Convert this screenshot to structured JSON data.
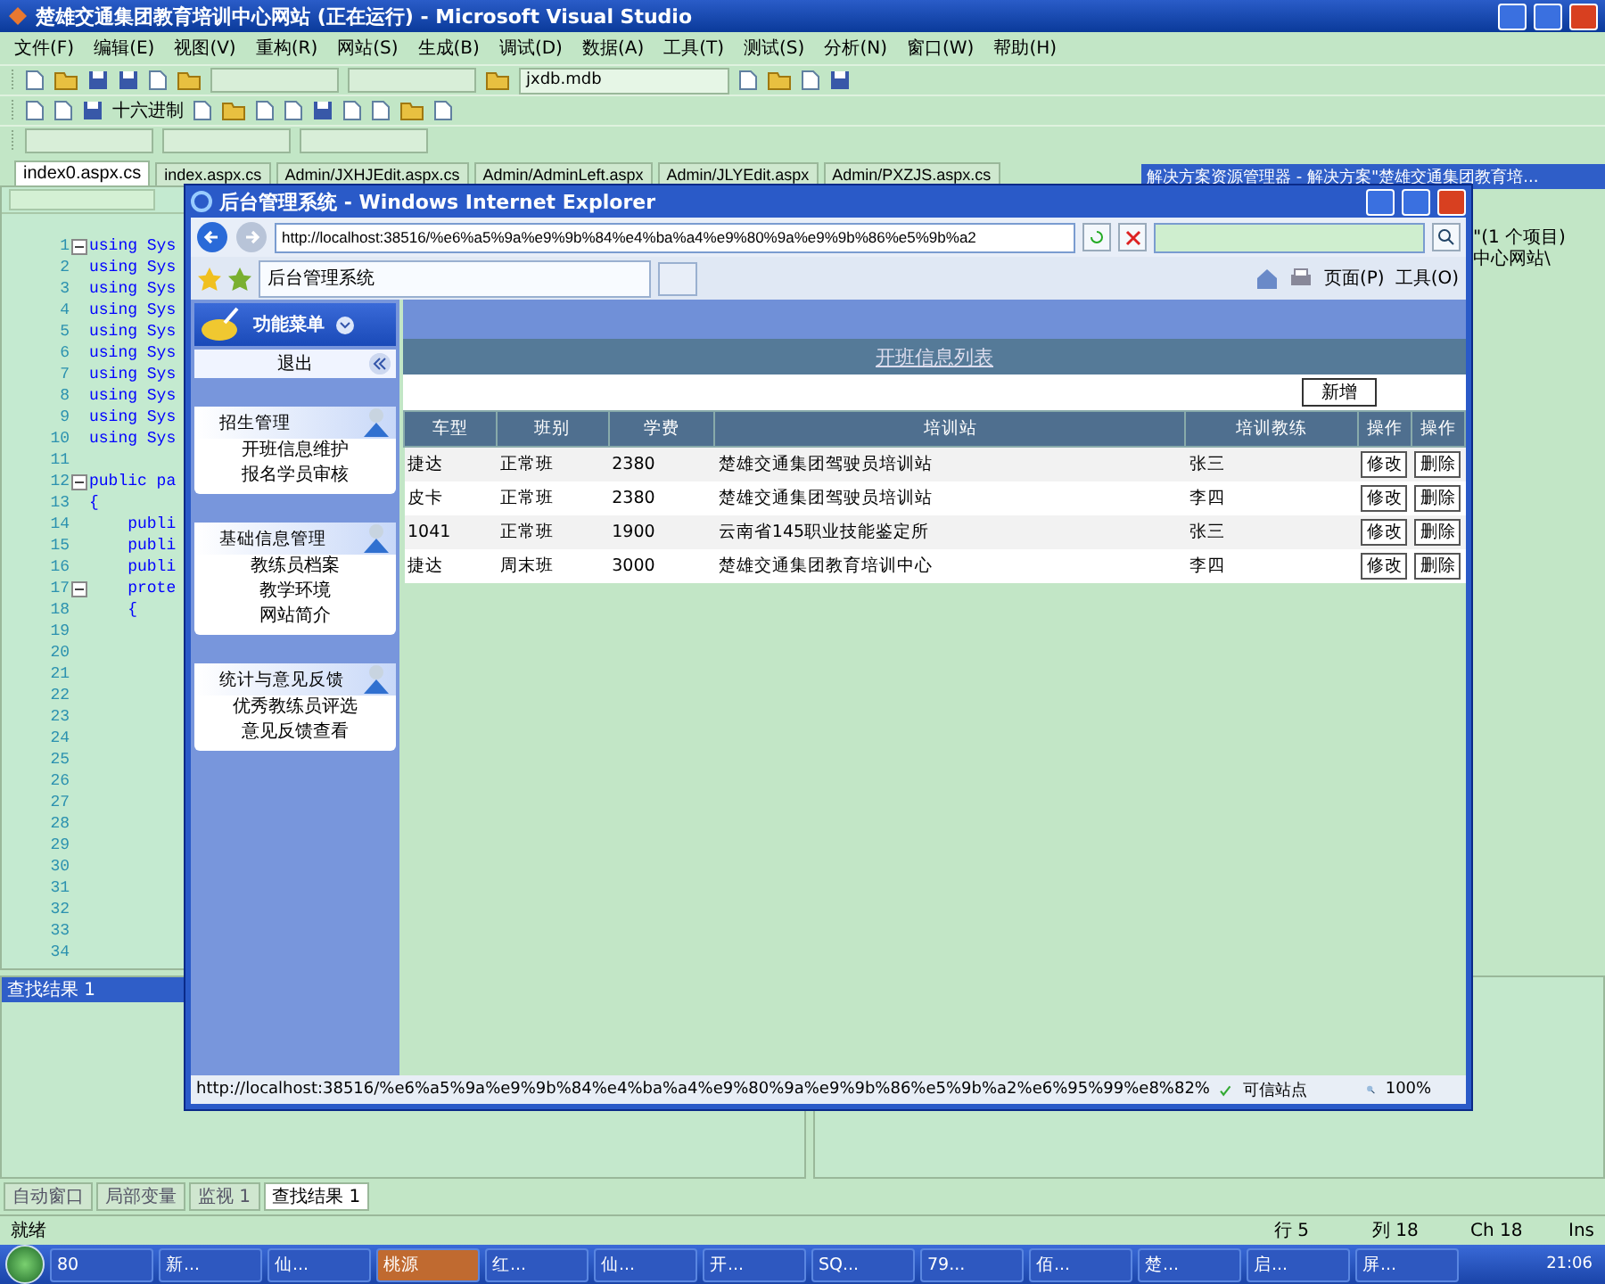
{
  "vs": {
    "title": "楚雄交通集团教育培训中心网站 (正在运行) - Microsoft Visual Studio",
    "menu": [
      "文件(F)",
      "编辑(E)",
      "视图(V)",
      "重构(R)",
      "网站(S)",
      "生成(B)",
      "调试(D)",
      "数据(A)",
      "工具(T)",
      "测试(S)",
      "分析(N)",
      "窗口(W)",
      "帮助(H)"
    ],
    "toolbar": {
      "db_combo": "jxdb.mdb",
      "hex_label": "十六进制"
    },
    "doc_tabs": [
      {
        "label": "index0.aspx.cs",
        "selected": true
      },
      {
        "label": "index.aspx.cs",
        "selected": false
      },
      {
        "label": "Admin/JXHJEdit.aspx.cs",
        "selected": false
      },
      {
        "label": "Admin/AdminLeft.aspx",
        "selected": false
      },
      {
        "label": "Admin/JLYEdit.aspx",
        "selected": false
      },
      {
        "label": "Admin/PXZJS.aspx.cs",
        "selected": false
      }
    ],
    "solution_explorer": {
      "title": "解决方案资源管理器 - 解决方案\"楚雄交通集团教育培...",
      "lines": [
        "\"(1 个项目)",
        "中心网站\\"
      ]
    },
    "editor": {
      "lines": [
        {
          "number": "1",
          "code": "using Sys",
          "fold": true
        },
        {
          "number": "2",
          "code": "using Sys",
          "fold": false
        },
        {
          "number": "3",
          "code": "using Sys",
          "fold": false
        },
        {
          "number": "4",
          "code": "using Sys",
          "fold": false
        },
        {
          "number": "5",
          "code": "using Sys",
          "fold": false
        },
        {
          "number": "6",
          "code": "using Sys",
          "fold": false
        },
        {
          "number": "7",
          "code": "using Sys",
          "fold": false
        },
        {
          "number": "8",
          "code": "using Sys",
          "fold": false
        },
        {
          "number": "9",
          "code": "using Sys",
          "fold": false
        },
        {
          "number": "10",
          "code": "using Sys",
          "fold": false
        },
        {
          "number": "11",
          "fold": false
        },
        {
          "number": "12",
          "code": "public pa",
          "fold": true
        },
        {
          "number": "13",
          "code": "{",
          "fold": false
        },
        {
          "number": "14",
          "code": "    publi",
          "fold": false
        },
        {
          "number": "15",
          "code": "    publi",
          "fold": false
        },
        {
          "number": "16",
          "code": "    publi",
          "fold": false
        },
        {
          "number": "17",
          "code": "    prote",
          "fold": true
        },
        {
          "number": "18",
          "code": "    {",
          "fold": false
        },
        {
          "number": "19",
          "fold": false
        },
        {
          "number": "20",
          "fold": false
        },
        {
          "number": "21",
          "fold": false
        },
        {
          "number": "22",
          "fold": false
        },
        {
          "number": "23",
          "fold": false
        },
        {
          "number": "24",
          "fold": false
        },
        {
          "number": "25",
          "fold": false
        },
        {
          "number": "26",
          "fold": false
        },
        {
          "number": "27",
          "fold": false
        },
        {
          "number": "28",
          "fold": false
        },
        {
          "number": "29",
          "fold": false
        },
        {
          "number": "30",
          "fold": false
        },
        {
          "number": "31",
          "fold": false
        },
        {
          "number": "32",
          "fold": false
        },
        {
          "number": "33",
          "fold": false
        },
        {
          "number": "34",
          "fold": false
        }
      ]
    },
    "find_panel": {
      "title": "查找结果 1"
    },
    "bottom_tabs": [
      {
        "label": "自动窗口",
        "selected": false
      },
      {
        "label": "局部变量",
        "selected": false
      },
      {
        "label": "监视 1",
        "selected": false
      },
      {
        "label": "查找结果 1",
        "selected": true
      }
    ],
    "status_bar": {
      "message": "就绪",
      "line": "行 5",
      "column": "列 18",
      "char": "Ch 18",
      "mode": "Ins"
    },
    "taskbar": {
      "items": [
        {
          "label": "80",
          "selected": false
        },
        {
          "label": "新...",
          "selected": false
        },
        {
          "label": "仙...",
          "selected": false
        },
        {
          "label": "桃源",
          "selected": true
        },
        {
          "label": "红...",
          "selected": false
        },
        {
          "label": "仙...",
          "selected": false
        },
        {
          "label": "开...",
          "selected": false
        },
        {
          "label": "SQ...",
          "selected": false
        },
        {
          "label": "79...",
          "selected": false
        },
        {
          "label": "佰...",
          "selected": false
        },
        {
          "label": "楚...",
          "selected": false
        },
        {
          "label": "启...",
          "selected": false
        },
        {
          "label": "屏...",
          "selected": false
        }
      ],
      "clock": "21:06"
    }
  },
  "ie": {
    "title": "后台管理系统 - Windows Internet Explorer",
    "address": "http://localhost:38516/%e6%a5%9a%e9%9b%84%e4%ba%a4%e9%80%9a%e9%9b%86%e5%9b%a2",
    "tab_label": "后台管理系统",
    "commands": [
      "页面(P)",
      "工具(O)"
    ],
    "sidebar": {
      "header": "功能菜单",
      "logout": "退出",
      "groups": [
        {
          "title": "招生管理",
          "items": [
            "开班信息维护",
            "报名学员审核"
          ]
        },
        {
          "title": "基础信息管理",
          "items": [
            "教练员档案",
            "教学环境",
            "网站简介"
          ]
        },
        {
          "title": "统计与意见反馈",
          "items": [
            "优秀教练员评选",
            "意见反馈查看"
          ]
        }
      ]
    },
    "page": {
      "title": "开班信息列表",
      "add_button": "新增"
    },
    "table": {
      "columns": [
        "车型",
        "班别",
        "学费",
        "培训站",
        "培训教练",
        "操作",
        "操作"
      ],
      "rows": [
        {
          "cells": [
            "捷达",
            "正常班",
            "2380",
            "楚雄交通集团驾驶员培训站",
            "张三"
          ],
          "actions": [
            "修改",
            "删除"
          ]
        },
        {
          "cells": [
            "皮卡",
            "正常班",
            "2380",
            "楚雄交通集团驾驶员培训站",
            "李四"
          ],
          "actions": [
            "修改",
            "删除"
          ]
        },
        {
          "cells": [
            "1041",
            "正常班",
            "1900",
            "云南省145职业技能鉴定所",
            "张三"
          ],
          "actions": [
            "修改",
            "删除"
          ]
        },
        {
          "cells": [
            "捷达",
            "周末班",
            "3000",
            "楚雄交通集团教育培训中心",
            "李四"
          ],
          "actions": [
            "修改",
            "删除"
          ]
        }
      ]
    },
    "status": {
      "url": "http://localhost:38516/%e6%a5%9a%e9%9b%84%e4%ba%a4%e9%80%9a%e9%9b%86%e5%9b%a2%e6%95%99%e8%82%",
      "zone": "可信站点",
      "zoom": "100%"
    }
  }
}
